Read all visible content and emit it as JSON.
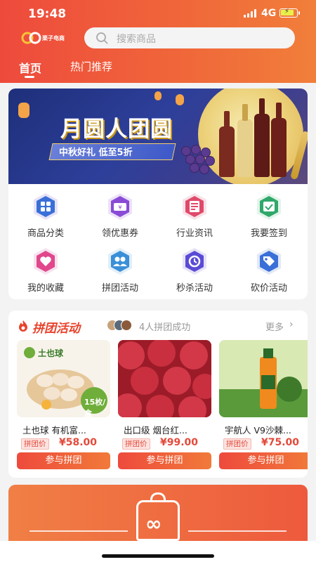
{
  "status_bar": {
    "time": "19:48",
    "network": "4G"
  },
  "header": {
    "logo_text": "栗子电商",
    "search_placeholder": "搜索商品",
    "tabs": [
      {
        "label": "首页",
        "active": true
      },
      {
        "label": "热门推荐",
        "active": false
      }
    ],
    "accent": "#ee4a3c"
  },
  "banner": {
    "title": "月圆人团圆",
    "subtitle": "中秋好礼 低至5折"
  },
  "quick_menu": [
    {
      "label": "商品分类",
      "icon": "grid-apps-icon",
      "color": "#3a6fd8"
    },
    {
      "label": "领优惠券",
      "icon": "coupon-ticket-icon",
      "color": "#8a4bd6"
    },
    {
      "label": "行业资讯",
      "icon": "news-icon",
      "color": "#e04a6a"
    },
    {
      "label": "我要签到",
      "icon": "calendar-check-icon",
      "color": "#2fa86a"
    },
    {
      "label": "我的收藏",
      "icon": "heart-icon",
      "color": "#e0478c"
    },
    {
      "label": "拼团活动",
      "icon": "group-users-icon",
      "color": "#3a8fd8"
    },
    {
      "label": "秒杀活动",
      "icon": "flash-sale-icon",
      "color": "#5a4bd6"
    },
    {
      "label": "砍价活动",
      "icon": "price-tag-icon",
      "color": "#3a6fd8"
    }
  ],
  "group_buy": {
    "title": "拼团活动",
    "success_text": "4人拼团成功",
    "more": "更多",
    "products": [
      {
        "name": "土也球 有机富...",
        "price_label": "拼团价",
        "price": "¥58.00",
        "button": "参与拼团",
        "image_brand": "土也球",
        "image_badge": "15枚/盒"
      },
      {
        "name": "出口级 烟台红...",
        "price_label": "拼团价",
        "price": "¥99.00",
        "button": "参与拼团"
      },
      {
        "name": "宇航人 V9沙棘...",
        "price_label": "拼团价",
        "price": "¥75.00",
        "button": "参与拼团"
      }
    ]
  }
}
